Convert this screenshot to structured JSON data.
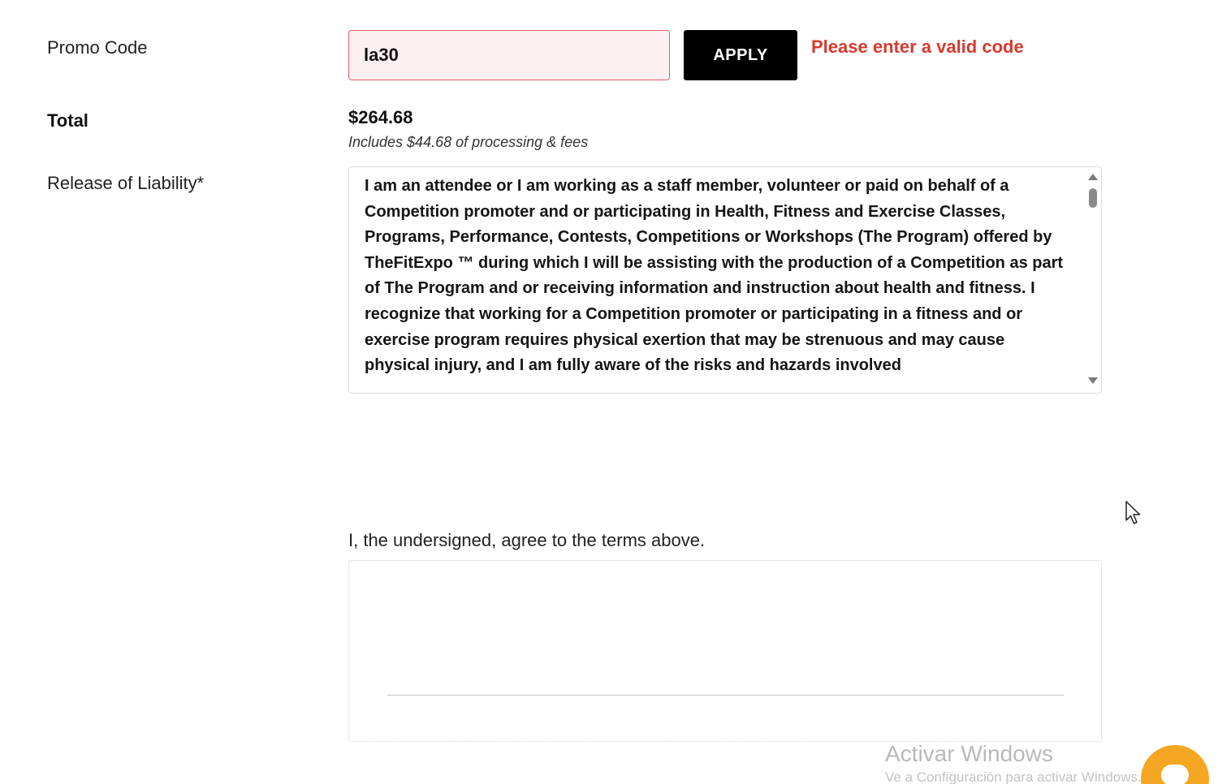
{
  "promo": {
    "label": "Promo Code",
    "value": "la30",
    "apply_label": "APPLY",
    "error": "Please enter a valid code"
  },
  "total": {
    "label": "Total",
    "amount": "$264.68",
    "fees_note": "Includes $44.68 of processing & fees"
  },
  "release": {
    "label": "Release of Liability*",
    "text": "I am an attendee or I am working as a staff member, volunteer or paid on behalf of a Competition promoter and or participating in Health, Fitness and Exercise Classes, Programs, Performance, Contests, Competitions or Workshops (The Program) offered by TheFitExpo ™ during which I will be assisting with the production of a Competition as part of The Program and or receiving information and instruction about health and fitness. I recognize that working for a Competition promoter or participating in a fitness and or exercise program requires physical exertion that may be strenuous and may cause physical injury, and I am fully aware of the risks and hazards involved"
  },
  "signature": {
    "agree_text": "I, the undersigned, agree to the terms above."
  },
  "watermark": {
    "title": "Activar Windows",
    "subtitle": "Ve a Configuración para activar Windows."
  },
  "icons": {
    "cursor": "mouse-pointer-icon",
    "chat": "chat-bubble-icon"
  },
  "colors": {
    "error": "#d63a2f",
    "input_error_border": "#e0616a",
    "input_error_bg": "#fdf0f0",
    "button_bg": "#000000",
    "chat_button": "#f5a623"
  }
}
